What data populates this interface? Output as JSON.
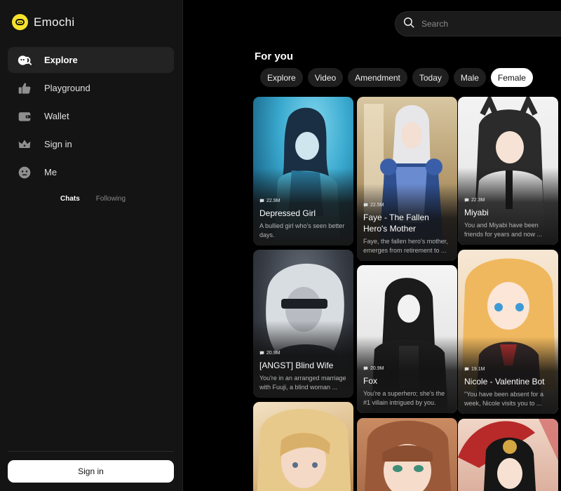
{
  "brand": {
    "name": "Emochi",
    "accent": "#f6e22b"
  },
  "nav": {
    "items": [
      {
        "label": "Explore",
        "icon": "explore-icon",
        "active": true
      },
      {
        "label": "Playground",
        "icon": "thumbs-up-icon",
        "active": false
      },
      {
        "label": "Wallet",
        "icon": "wallet-icon",
        "active": false
      },
      {
        "label": "Sign in",
        "icon": "crown-icon",
        "active": false
      },
      {
        "label": "Me",
        "icon": "face-icon",
        "active": false
      }
    ]
  },
  "subtabs": {
    "chats": "Chats",
    "following": "Following"
  },
  "sidebar_footer": {
    "signin_label": "Sign in"
  },
  "search": {
    "placeholder": "Search"
  },
  "main": {
    "section_title": "For you",
    "filters": [
      "Explore",
      "Video",
      "Amendment",
      "Today",
      "Male",
      "Female"
    ],
    "active_filter": "Female"
  },
  "cards": [
    {
      "name": "Depressed Girl",
      "count": "22.9M",
      "desc": "A bullied girl who's seen better days."
    },
    {
      "name": "Faye - The Fallen Hero's Mother",
      "count": "22.5M",
      "desc": "Faye, the fallen hero's mother, emerges from retirement to ..."
    },
    {
      "name": "Miyabi",
      "count": "22.3M",
      "desc": "You and Miyabi have been friends for years and now ..."
    },
    {
      "name": "[ANGST] Blind Wife",
      "count": "20.9M",
      "desc": "You're in an arranged marriage with Fuuji, a blind woman ..."
    },
    {
      "name": "Fox",
      "count": "20.9M",
      "desc": "You're a superhero; she's the #1 villain intrigued by you."
    },
    {
      "name": "Nicole - Valentine Bot",
      "count": "19.1M",
      "desc": "\"You have been absent for a week, Nicole visits you to ..."
    },
    {
      "name": "",
      "count": "",
      "desc": ""
    },
    {
      "name": "",
      "count": "",
      "desc": ""
    },
    {
      "name": "",
      "count": "",
      "desc": ""
    }
  ]
}
